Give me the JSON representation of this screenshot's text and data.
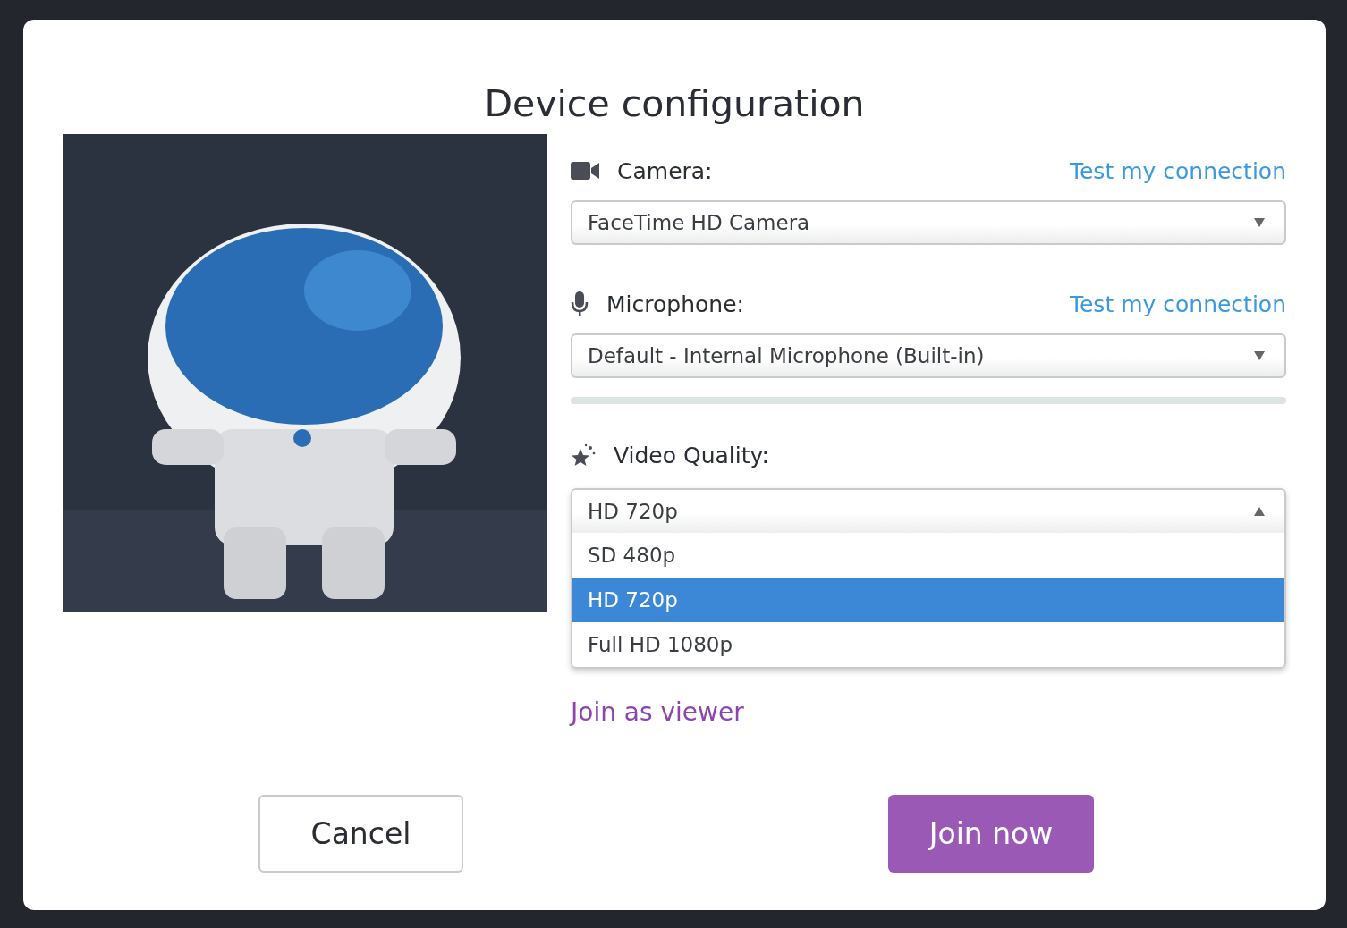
{
  "dialog": {
    "title": "Device configuration"
  },
  "camera": {
    "label": "Camera:",
    "link": "Test my connection",
    "value": "FaceTime HD Camera",
    "expanded": false
  },
  "microphone": {
    "label": "Microphone:",
    "link": "Test my connection",
    "value": "Default - Internal Microphone (Built-in)",
    "expanded": false
  },
  "video_quality": {
    "label": "Video Quality:",
    "value": "HD 720p",
    "expanded": true,
    "options": [
      {
        "label": "SD 480p",
        "selected": false
      },
      {
        "label": "HD 720p",
        "selected": true
      },
      {
        "label": "Full HD 1080p",
        "selected": false
      }
    ]
  },
  "viewer_link": "Join as viewer",
  "buttons": {
    "cancel": "Cancel",
    "join": "Join now"
  }
}
